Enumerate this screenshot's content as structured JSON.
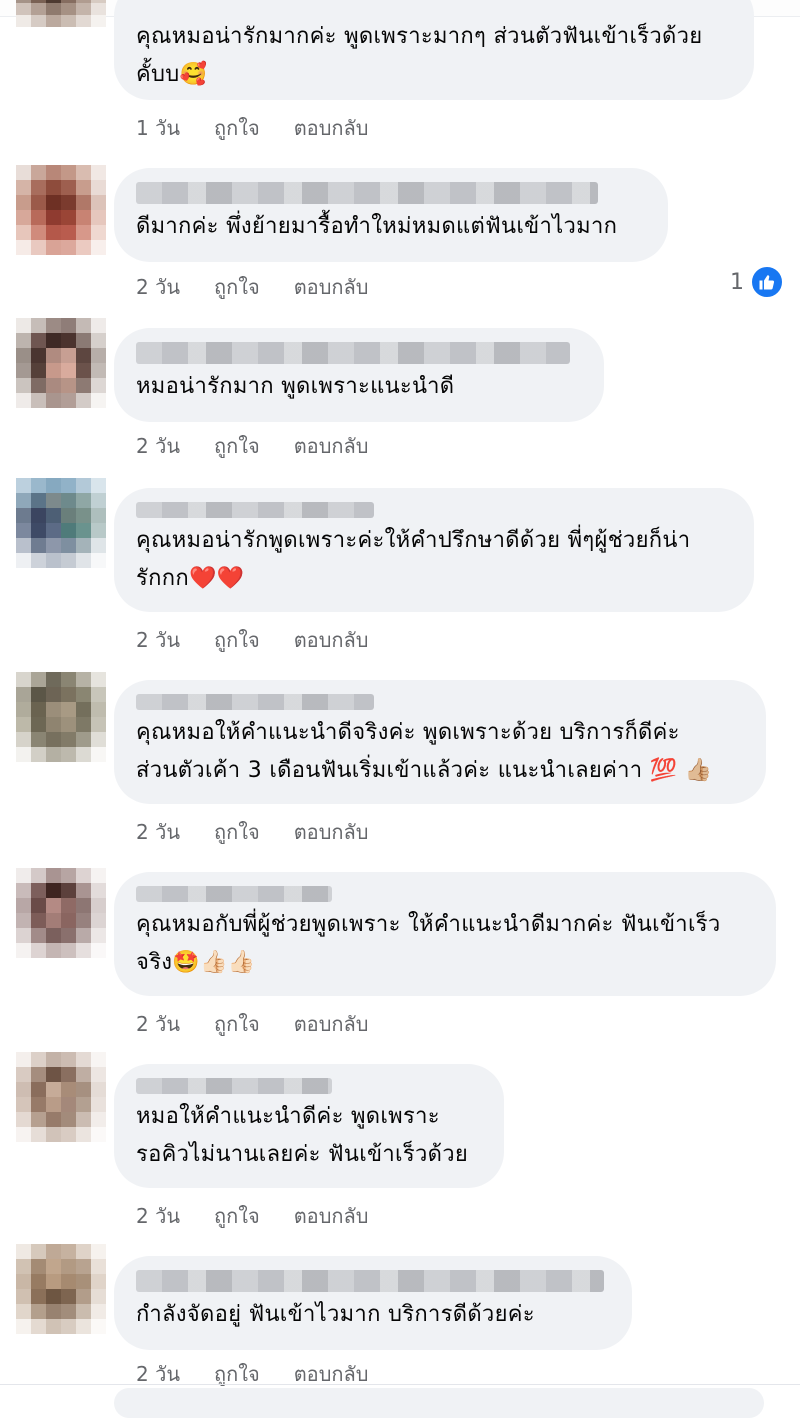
{
  "comments": [
    {
      "text": "คุณหมอน่ารักมากค่ะ พูดเพราะมากๆ ส่วนตัวฟันเข้าเร็วด้วยคั้บบ",
      "text_line1": "คุณหมอน่ารักมากค่ะ พูดเพราะมากๆ ส่วนตัวฟันเข้าเร็วด้วย",
      "text_line2": "คั้บบ",
      "emoji": "🥰",
      "time": "1 วัน",
      "like_label": "ถูกใจ",
      "reply_label": "ตอบกลับ"
    },
    {
      "text": "ดีมากค่ะ พึ่งย้ายมารื้อทำใหม่หมดแต่ฟันเข้าไวมาก",
      "time": "2 วัน",
      "like_label": "ถูกใจ",
      "reply_label": "ตอบกลับ",
      "reaction_count": "1"
    },
    {
      "text": "หมอน่ารักมาก พูดเพราะแนะนำดี",
      "time": "2 วัน",
      "like_label": "ถูกใจ",
      "reply_label": "ตอบกลับ"
    },
    {
      "text_line1": "คุณหมอน่ารักพูดเพราะค่ะให้คำปรึกษาดีด้วย พี่ๆผู้ช่วยก็น่า",
      "text_line2": "รักกก",
      "emoji": "❤️❤️",
      "time": "2 วัน",
      "like_label": "ถูกใจ",
      "reply_label": "ตอบกลับ"
    },
    {
      "text_line1": "คุณหมอให้คำแนะนำดีจริงค่ะ พูดเพราะด้วย บริการก็ดีค่ะ",
      "text_line2": "ส่วนตัวเค้า 3 เดือนฟันเริ่มเข้าแล้วค่ะ แนะนำเลยค่าา ",
      "emoji": "💯 👍🏼",
      "time": "2 วัน",
      "like_label": "ถูกใจ",
      "reply_label": "ตอบกลับ"
    },
    {
      "text_line1": "คุณหมอกับพี่ผู้ช่วยพูดเพราะ ให้คำแนะนำดีมากค่ะ ฟันเข้าเร็ว",
      "text_line2": "จริง",
      "emoji": "🤩👍🏻👍🏻",
      "time": "2 วัน",
      "like_label": "ถูกใจ",
      "reply_label": "ตอบกลับ"
    },
    {
      "text_line1": "หมอให้คำแนะนำดีค่ะ พูดเพราะ",
      "text_line2": "รอคิวไม่นานเลยค่ะ ฟันเข้าเร็วด้วย",
      "time": "2 วัน",
      "like_label": "ถูกใจ",
      "reply_label": "ตอบกลับ"
    },
    {
      "text": "กำลังจัดอยู่ ฟันเข้าไวมาก บริการดีด้วยค่ะ",
      "time": "2 วัน",
      "like_label": "ถูกใจ",
      "reply_label": "ตอบกลับ"
    }
  ],
  "icons": {
    "like_reaction": "thumbs-up-icon",
    "avatar": "pixelated-avatar"
  },
  "colors": {
    "bubble": "#f0f2f5",
    "meta_text": "#65676b",
    "like_blue": "#1877f2"
  }
}
